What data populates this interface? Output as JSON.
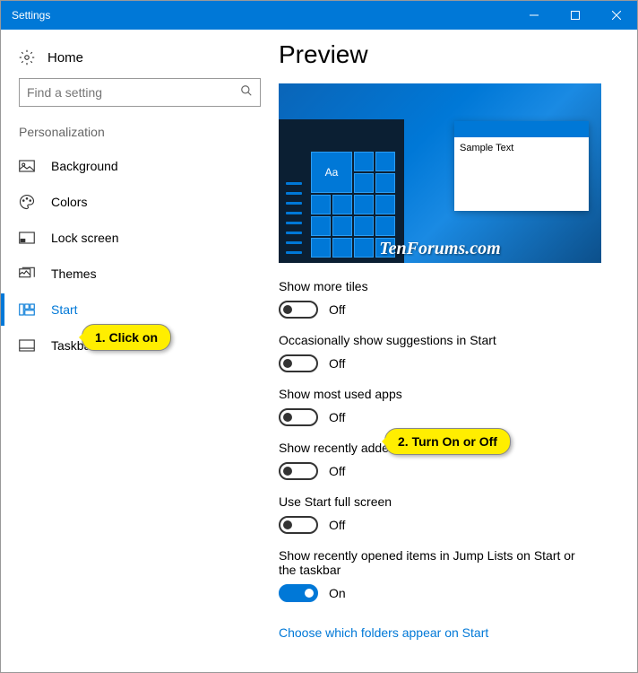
{
  "window": {
    "title": "Settings"
  },
  "sidebar": {
    "home": "Home",
    "search_placeholder": "Find a setting",
    "category": "Personalization",
    "items": [
      {
        "label": "Background"
      },
      {
        "label": "Colors"
      },
      {
        "label": "Lock screen"
      },
      {
        "label": "Themes"
      },
      {
        "label": "Start"
      },
      {
        "label": "Taskbar"
      }
    ]
  },
  "main": {
    "heading": "Preview",
    "sample_text": "Sample Text",
    "tile_label": "Aa",
    "watermark": "TenForums.com",
    "settings": [
      {
        "label": "Show more tiles",
        "state": "Off",
        "on": false
      },
      {
        "label": "Occasionally show suggestions in Start",
        "state": "Off",
        "on": false
      },
      {
        "label": "Show most used apps",
        "state": "Off",
        "on": false
      },
      {
        "label": "Show recently added apps",
        "state": "Off",
        "on": false
      },
      {
        "label": "Use Start full screen",
        "state": "Off",
        "on": false
      },
      {
        "label": "Show recently opened items in Jump Lists on Start or the taskbar",
        "state": "On",
        "on": true
      }
    ],
    "link": "Choose which folders appear on Start"
  },
  "callouts": {
    "c1": "1. Click on",
    "c2": "2. Turn On or Off"
  }
}
